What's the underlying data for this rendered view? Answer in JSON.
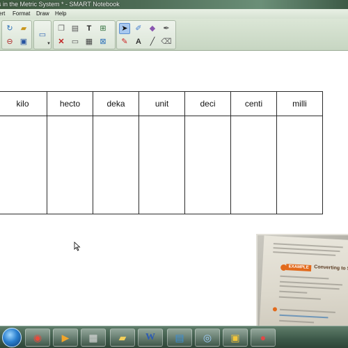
{
  "window": {
    "title": "s in the Metric System * - SMART Notebook"
  },
  "menu": [
    "ert",
    "Format",
    "Draw",
    "Help"
  ],
  "toolbar": {
    "buttons": [
      {
        "name": "redo-icon",
        "glyph": "↻"
      },
      {
        "name": "open-folder-icon",
        "glyph": "📂"
      },
      {
        "name": "delete-page-icon",
        "glyph": "⊖"
      },
      {
        "name": "save-icon",
        "glyph": "💾"
      },
      {
        "name": "display-icon",
        "glyph": "🖥"
      },
      {
        "name": "paste-icon",
        "glyph": "📋"
      },
      {
        "name": "delete-icon",
        "glyph": "✕"
      },
      {
        "name": "screen-shade-icon",
        "glyph": "▭"
      },
      {
        "name": "table-icon",
        "glyph": "▦"
      },
      {
        "name": "text-tool-icon",
        "glyph": "T"
      },
      {
        "name": "properties-icon",
        "glyph": "⊞"
      },
      {
        "name": "select-icon",
        "glyph": "➤"
      },
      {
        "name": "pens-icon",
        "glyph": "✎"
      },
      {
        "name": "eraser-icon",
        "glyph": "⌫"
      },
      {
        "name": "line-icon",
        "glyph": "╱"
      },
      {
        "name": "shapes-icon",
        "glyph": "◯"
      },
      {
        "name": "fill-icon",
        "glyph": "A"
      }
    ]
  },
  "metric_table": {
    "headers": [
      "kilo",
      "hecto",
      "deka",
      "unit",
      "deci",
      "centi",
      "milli"
    ]
  },
  "webcam": {
    "example_label": "EXAMPLE",
    "example_title": "Converting to Smaller"
  },
  "taskbar": {
    "apps": [
      "chrome-icon",
      "explorer-icon",
      "media-player-icon",
      "film-icon",
      "folder-icon",
      "word-icon",
      "notepad-icon",
      "webcam-icon",
      "smart-notebook-icon",
      "video-recorder-icon"
    ]
  }
}
